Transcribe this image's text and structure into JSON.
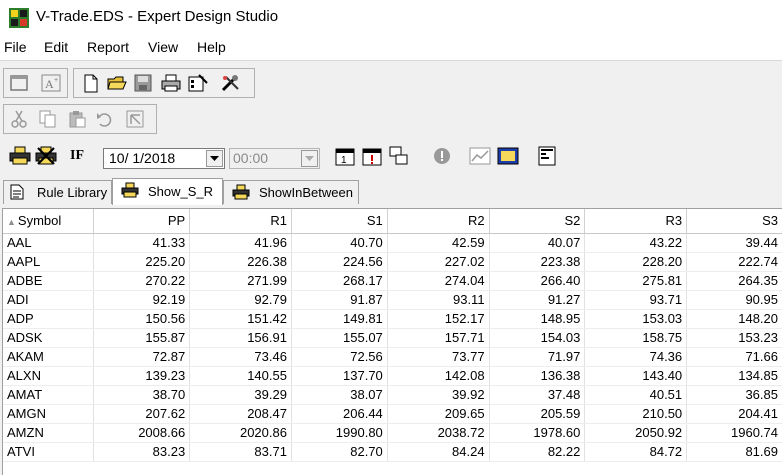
{
  "window": {
    "title": "V-Trade.EDS - Expert Design Studio"
  },
  "menu": [
    "File",
    "Edit",
    "Report",
    "View",
    "Help"
  ],
  "toolbar": {
    "date_value": "10/ 1/2018",
    "time_value": "00:00",
    "if_label": "IF"
  },
  "tabs": [
    {
      "label": "Rule Library",
      "icon": "document-icon",
      "active": false
    },
    {
      "label": "Show_S_R",
      "icon": "printer-icon",
      "active": true
    },
    {
      "label": "ShowInBetween",
      "icon": "printer-icon",
      "active": false
    }
  ],
  "grid": {
    "sort_column": "Symbol",
    "sort_direction": "ascending",
    "columns": [
      "Symbol",
      "PP",
      "R1",
      "S1",
      "R2",
      "S2",
      "R3",
      "S3"
    ],
    "rows": [
      [
        "AAL",
        "41.33",
        "41.96",
        "40.70",
        "42.59",
        "40.07",
        "43.22",
        "39.44"
      ],
      [
        "AAPL",
        "225.20",
        "226.38",
        "224.56",
        "227.02",
        "223.38",
        "228.20",
        "222.74"
      ],
      [
        "ADBE",
        "270.22",
        "271.99",
        "268.17",
        "274.04",
        "266.40",
        "275.81",
        "264.35"
      ],
      [
        "ADI",
        "92.19",
        "92.79",
        "91.87",
        "93.11",
        "91.27",
        "93.71",
        "90.95"
      ],
      [
        "ADP",
        "150.56",
        "151.42",
        "149.81",
        "152.17",
        "148.95",
        "153.03",
        "148.20"
      ],
      [
        "ADSK",
        "155.87",
        "156.91",
        "155.07",
        "157.71",
        "154.03",
        "158.75",
        "153.23"
      ],
      [
        "AKAM",
        "72.87",
        "73.46",
        "72.56",
        "73.77",
        "71.97",
        "74.36",
        "71.66"
      ],
      [
        "ALXN",
        "139.23",
        "140.55",
        "137.70",
        "142.08",
        "136.38",
        "143.40",
        "134.85"
      ],
      [
        "AMAT",
        "38.70",
        "39.29",
        "38.07",
        "39.92",
        "37.48",
        "40.51",
        "36.85"
      ],
      [
        "AMGN",
        "207.62",
        "208.47",
        "206.44",
        "209.65",
        "205.59",
        "210.50",
        "204.41"
      ],
      [
        "AMZN",
        "2008.66",
        "2020.86",
        "1990.80",
        "2038.72",
        "1978.60",
        "2050.92",
        "1960.74"
      ],
      [
        "ATVI",
        "83.23",
        "83.71",
        "82.70",
        "84.24",
        "82.22",
        "84.72",
        "81.69"
      ]
    ]
  }
}
